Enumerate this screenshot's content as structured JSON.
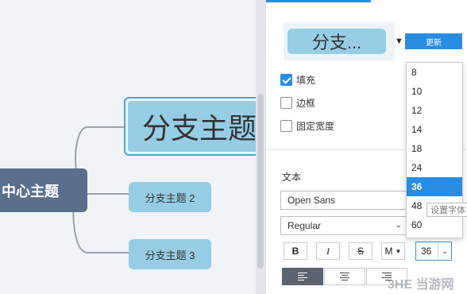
{
  "canvas": {
    "central_topic": "中心主题",
    "selected_branch": "分支主题",
    "branches": [
      "分支主题 2",
      "分支主题 3"
    ]
  },
  "panel": {
    "preview_text": "分支...",
    "update_button": "更新",
    "checkboxes": [
      {
        "label": "填充",
        "checked": true
      },
      {
        "label": "边框",
        "checked": false
      },
      {
        "label": "固定宽度",
        "checked": false
      }
    ],
    "text_section_label": "文本",
    "font_family": "Open Sans",
    "font_style": "Regular",
    "format_buttons": [
      "B",
      "I",
      "S",
      "M"
    ],
    "font_size": "36",
    "font_size_options": [
      "8",
      "10",
      "12",
      "14",
      "18",
      "24",
      "36",
      "48",
      "60"
    ],
    "selected_font_size": "36",
    "tooltip": "设置字体"
  },
  "watermark": "3HE 当游网",
  "colors": {
    "accent": "#2a8ce0",
    "branch_fill": "#96cde4",
    "central_fill": "#5a6f8e",
    "selection_border": "#4da3d8"
  }
}
